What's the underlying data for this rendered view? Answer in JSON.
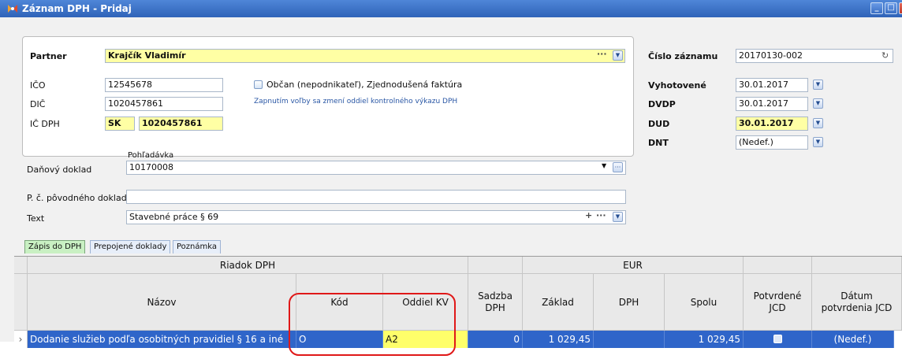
{
  "window": {
    "title": "Záznam DPH - Pridaj"
  },
  "partner": {
    "label": "Partner",
    "value": "Krajčík Vladimír",
    "ico_label": "IČO",
    "ico": "12545678",
    "dic_label": "DIČ",
    "dic": "1020457861",
    "icdph_label": "IČ DPH",
    "icdph_prefix": "SK",
    "icdph": "1020457861",
    "citizen_label": "Občan (nepodnikateľ), Zjednodušená faktúra",
    "citizen_checked": false,
    "note": "Zapnutím voľby sa zmení oddiel kontrolného výkazu DPH"
  },
  "record": {
    "cislo_label": "Číslo záznamu",
    "cislo": "20170130-002",
    "vyhotovene_label": "Vyhotovené",
    "vyhotovene": "30.01.2017",
    "dvdp_label": "DVDP",
    "dvdp": "30.01.2017",
    "dud_label": "DUD",
    "dud": "30.01.2017",
    "dnt_label": "DNT",
    "dnt": "(Nedef.)"
  },
  "doc": {
    "pohladavka_label": "Pohľadávka",
    "danovy_label": "Daňový doklad",
    "danovy": "10170008",
    "povodny_label": "P. č. pôvodného dokladu",
    "povodny": "",
    "text_label": "Text",
    "text": "Stavebné práce § 69"
  },
  "tabs": [
    {
      "label": "Zápis do DPH",
      "active": true
    },
    {
      "label": "Prepojené doklady",
      "active": false
    },
    {
      "label": "Poznámka",
      "active": false
    }
  ],
  "grid": {
    "group_riadok": "Riadok DPH",
    "group_eur": "EUR",
    "headers": {
      "nazov": "Názov",
      "kod": "Kód",
      "oddiel": "Oddiel KV",
      "sadzba": "Sadzba DPH",
      "zaklad": "Základ",
      "dph": "DPH",
      "spolu": "Spolu",
      "potvrdene": "Potvrdené JCD",
      "datum": "Dátum potvrdenia JCD"
    },
    "rows": [
      {
        "nazov": "Dodanie služieb podľa osobitných pravidiel § 16 a iné",
        "kod": "O",
        "oddiel": "A2",
        "sadzba": "0",
        "zaklad": "1 029,45",
        "dph": "",
        "spolu": "1 029,45",
        "potvrdene": false,
        "datum": "(Nedef.)"
      }
    ]
  },
  "colors": {
    "selection": "#2f65c9",
    "highlight": "#ffffa4",
    "title": "#2f63b8",
    "annotation": "#e01818"
  }
}
